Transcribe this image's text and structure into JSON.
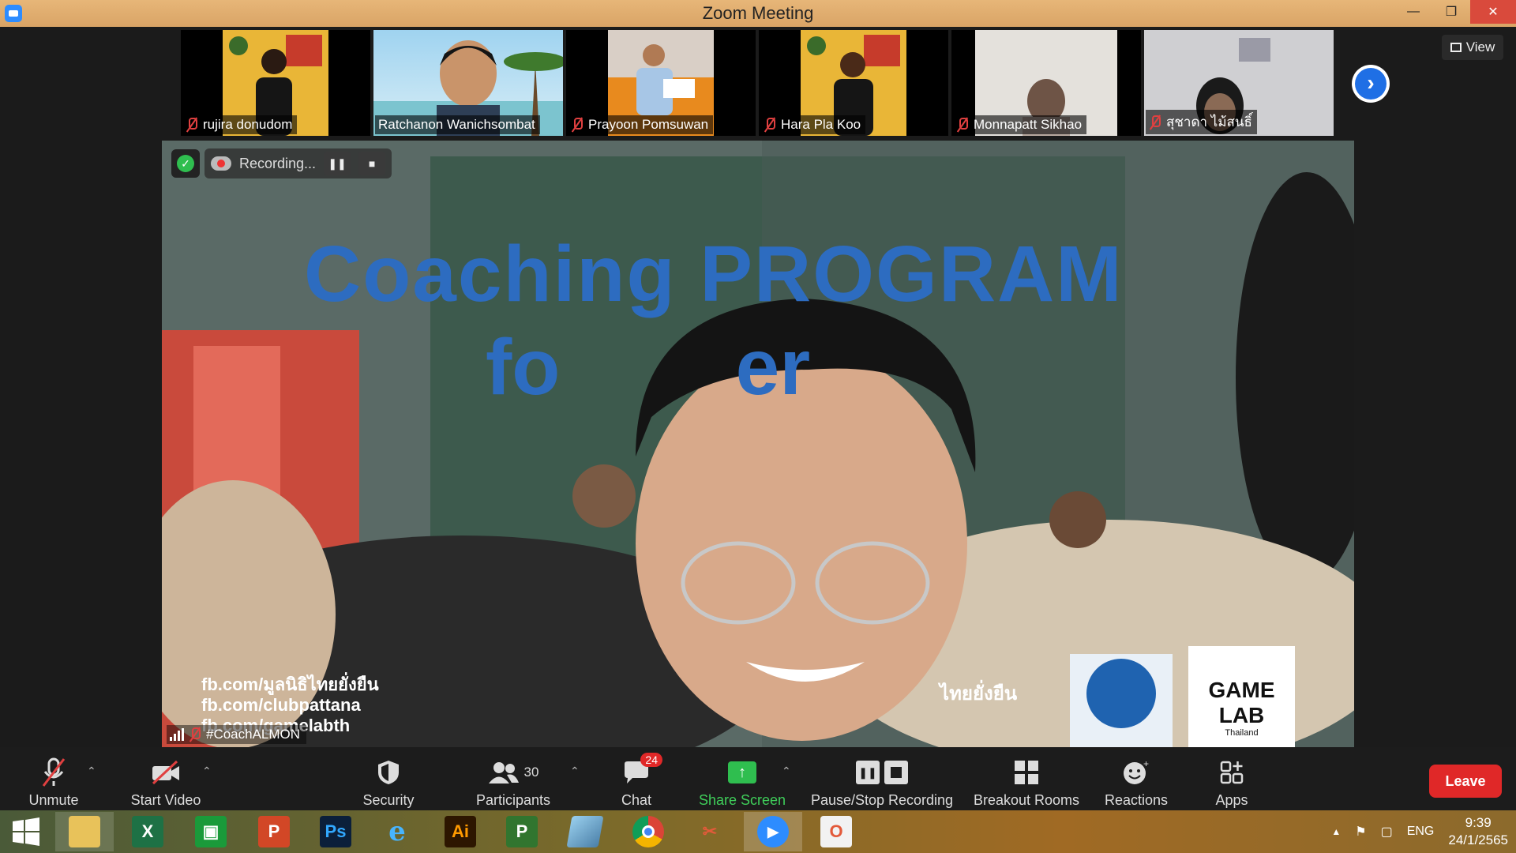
{
  "window": {
    "title": "Zoom Meeting"
  },
  "participants": [
    {
      "name": "rujira donudom"
    },
    {
      "name": "Ratchanon Wanichsombat"
    },
    {
      "name": "Prayoon Pomsuwan"
    },
    {
      "name": "Hara Pla Koo"
    },
    {
      "name": "Monnapatt Sikhao"
    },
    {
      "name": "สุชาดา ไม้สนธิ์"
    }
  ],
  "view_label": "View",
  "recording": {
    "label": "Recording..."
  },
  "main_video": {
    "speaker": "#CoachALMON",
    "slide_title_line1": "Coaching PROGRAM",
    "slide_title_line2": "fo        er",
    "links": [
      "fb.com/มูลนิธิไทยยั่งยืน",
      "fb.com/clubpattana",
      "fb.com/gamelabth"
    ],
    "logo_text": "ไทยยั่งยืน",
    "gamelab_text": "GAME LAB",
    "gamelab_sub": "Thailand"
  },
  "toolbar": {
    "unmute": "Unmute",
    "start_video": "Start Video",
    "security": "Security",
    "participants": "Participants",
    "participants_count": "30",
    "chat": "Chat",
    "chat_badge": "24",
    "share_screen": "Share Screen",
    "pause_stop": "Pause/Stop Recording",
    "breakout": "Breakout Rooms",
    "reactions": "Reactions",
    "apps": "Apps",
    "leave": "Leave"
  },
  "taskbar": {
    "apps": [
      "start",
      "file-explorer",
      "excel",
      "store",
      "powerpoint",
      "photoshop",
      "internet-explorer",
      "illustrator",
      "project",
      "paint",
      "chrome",
      "snipping",
      "zoom",
      "office"
    ],
    "lang": "ENG",
    "time": "9:39",
    "date": "24/1/2565"
  },
  "colors": {
    "titlebar": "#e0ac6e",
    "leave": "#e02828",
    "share": "#2fbe4f",
    "accent": "#1f6fe5"
  }
}
